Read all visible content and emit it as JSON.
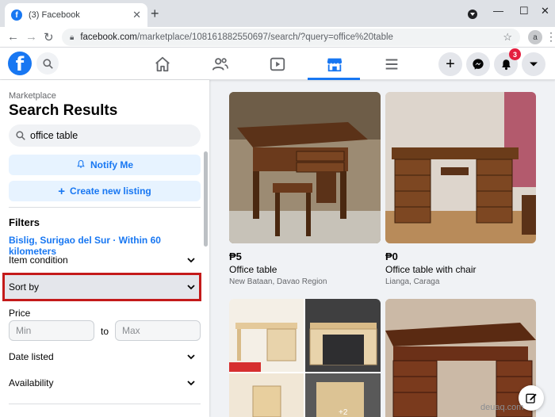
{
  "browser": {
    "tab_title": "(3) Facebook",
    "tab_favicon": "f",
    "new_tab": "+",
    "close_tab": "✕",
    "url_host": "facebook.com",
    "url_rest": "/marketplace/108161882550697/search/?query=office%20table",
    "profile_initial": "a"
  },
  "fb": {
    "notification_count": "3",
    "logo_letter": "f",
    "create_label": "+"
  },
  "sidebar": {
    "breadcrumb": "Marketplace",
    "title": "Search Results",
    "search_value": "office table",
    "notify_label": "Notify Me",
    "create_listing_label": "Create new listing",
    "filters_heading": "Filters",
    "location": "Bislig, Surigao del Sur · Within 60 kilometers",
    "item_condition": "Item condition",
    "sort_by": "Sort by",
    "price_label": "Price",
    "min_placeholder": "Min",
    "to_label": "to",
    "max_placeholder": "Max",
    "date_listed": "Date listed",
    "availability": "Availability"
  },
  "listings": [
    {
      "price": "₱5",
      "title": "Office table",
      "location": "New Bataan, Davao Region"
    },
    {
      "price": "₱0",
      "title": "Office table with chair",
      "location": "Lianga, Caraga"
    }
  ],
  "collage_more": "+2",
  "watermark": "deuaq.com",
  "colors": {
    "fb_blue": "#1877f2",
    "highlight_red": "#c41a1a",
    "badge_red": "#e41e3f"
  }
}
